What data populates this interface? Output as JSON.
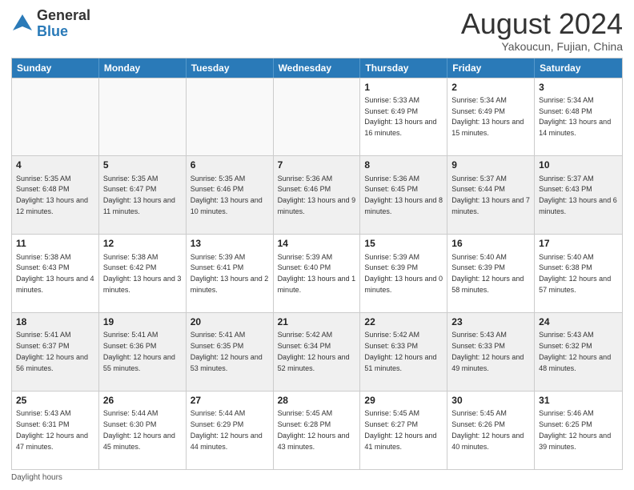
{
  "logo": {
    "general": "General",
    "blue": "Blue"
  },
  "title": "August 2024",
  "subtitle": "Yakoucun, Fujian, China",
  "days": [
    "Sunday",
    "Monday",
    "Tuesday",
    "Wednesday",
    "Thursday",
    "Friday",
    "Saturday"
  ],
  "rows": [
    [
      {
        "day": "",
        "info": ""
      },
      {
        "day": "",
        "info": ""
      },
      {
        "day": "",
        "info": ""
      },
      {
        "day": "",
        "info": ""
      },
      {
        "day": "1",
        "info": "Sunrise: 5:33 AM\nSunset: 6:49 PM\nDaylight: 13 hours and 16 minutes."
      },
      {
        "day": "2",
        "info": "Sunrise: 5:34 AM\nSunset: 6:49 PM\nDaylight: 13 hours and 15 minutes."
      },
      {
        "day": "3",
        "info": "Sunrise: 5:34 AM\nSunset: 6:48 PM\nDaylight: 13 hours and 14 minutes."
      }
    ],
    [
      {
        "day": "4",
        "info": "Sunrise: 5:35 AM\nSunset: 6:48 PM\nDaylight: 13 hours and 12 minutes."
      },
      {
        "day": "5",
        "info": "Sunrise: 5:35 AM\nSunset: 6:47 PM\nDaylight: 13 hours and 11 minutes."
      },
      {
        "day": "6",
        "info": "Sunrise: 5:35 AM\nSunset: 6:46 PM\nDaylight: 13 hours and 10 minutes."
      },
      {
        "day": "7",
        "info": "Sunrise: 5:36 AM\nSunset: 6:46 PM\nDaylight: 13 hours and 9 minutes."
      },
      {
        "day": "8",
        "info": "Sunrise: 5:36 AM\nSunset: 6:45 PM\nDaylight: 13 hours and 8 minutes."
      },
      {
        "day": "9",
        "info": "Sunrise: 5:37 AM\nSunset: 6:44 PM\nDaylight: 13 hours and 7 minutes."
      },
      {
        "day": "10",
        "info": "Sunrise: 5:37 AM\nSunset: 6:43 PM\nDaylight: 13 hours and 6 minutes."
      }
    ],
    [
      {
        "day": "11",
        "info": "Sunrise: 5:38 AM\nSunset: 6:43 PM\nDaylight: 13 hours and 4 minutes."
      },
      {
        "day": "12",
        "info": "Sunrise: 5:38 AM\nSunset: 6:42 PM\nDaylight: 13 hours and 3 minutes."
      },
      {
        "day": "13",
        "info": "Sunrise: 5:39 AM\nSunset: 6:41 PM\nDaylight: 13 hours and 2 minutes."
      },
      {
        "day": "14",
        "info": "Sunrise: 5:39 AM\nSunset: 6:40 PM\nDaylight: 13 hours and 1 minute."
      },
      {
        "day": "15",
        "info": "Sunrise: 5:39 AM\nSunset: 6:39 PM\nDaylight: 13 hours and 0 minutes."
      },
      {
        "day": "16",
        "info": "Sunrise: 5:40 AM\nSunset: 6:39 PM\nDaylight: 12 hours and 58 minutes."
      },
      {
        "day": "17",
        "info": "Sunrise: 5:40 AM\nSunset: 6:38 PM\nDaylight: 12 hours and 57 minutes."
      }
    ],
    [
      {
        "day": "18",
        "info": "Sunrise: 5:41 AM\nSunset: 6:37 PM\nDaylight: 12 hours and 56 minutes."
      },
      {
        "day": "19",
        "info": "Sunrise: 5:41 AM\nSunset: 6:36 PM\nDaylight: 12 hours and 55 minutes."
      },
      {
        "day": "20",
        "info": "Sunrise: 5:41 AM\nSunset: 6:35 PM\nDaylight: 12 hours and 53 minutes."
      },
      {
        "day": "21",
        "info": "Sunrise: 5:42 AM\nSunset: 6:34 PM\nDaylight: 12 hours and 52 minutes."
      },
      {
        "day": "22",
        "info": "Sunrise: 5:42 AM\nSunset: 6:33 PM\nDaylight: 12 hours and 51 minutes."
      },
      {
        "day": "23",
        "info": "Sunrise: 5:43 AM\nSunset: 6:33 PM\nDaylight: 12 hours and 49 minutes."
      },
      {
        "day": "24",
        "info": "Sunrise: 5:43 AM\nSunset: 6:32 PM\nDaylight: 12 hours and 48 minutes."
      }
    ],
    [
      {
        "day": "25",
        "info": "Sunrise: 5:43 AM\nSunset: 6:31 PM\nDaylight: 12 hours and 47 minutes."
      },
      {
        "day": "26",
        "info": "Sunrise: 5:44 AM\nSunset: 6:30 PM\nDaylight: 12 hours and 45 minutes."
      },
      {
        "day": "27",
        "info": "Sunrise: 5:44 AM\nSunset: 6:29 PM\nDaylight: 12 hours and 44 minutes."
      },
      {
        "day": "28",
        "info": "Sunrise: 5:45 AM\nSunset: 6:28 PM\nDaylight: 12 hours and 43 minutes."
      },
      {
        "day": "29",
        "info": "Sunrise: 5:45 AM\nSunset: 6:27 PM\nDaylight: 12 hours and 41 minutes."
      },
      {
        "day": "30",
        "info": "Sunrise: 5:45 AM\nSunset: 6:26 PM\nDaylight: 12 hours and 40 minutes."
      },
      {
        "day": "31",
        "info": "Sunrise: 5:46 AM\nSunset: 6:25 PM\nDaylight: 12 hours and 39 minutes."
      }
    ]
  ],
  "footer": "Daylight hours"
}
